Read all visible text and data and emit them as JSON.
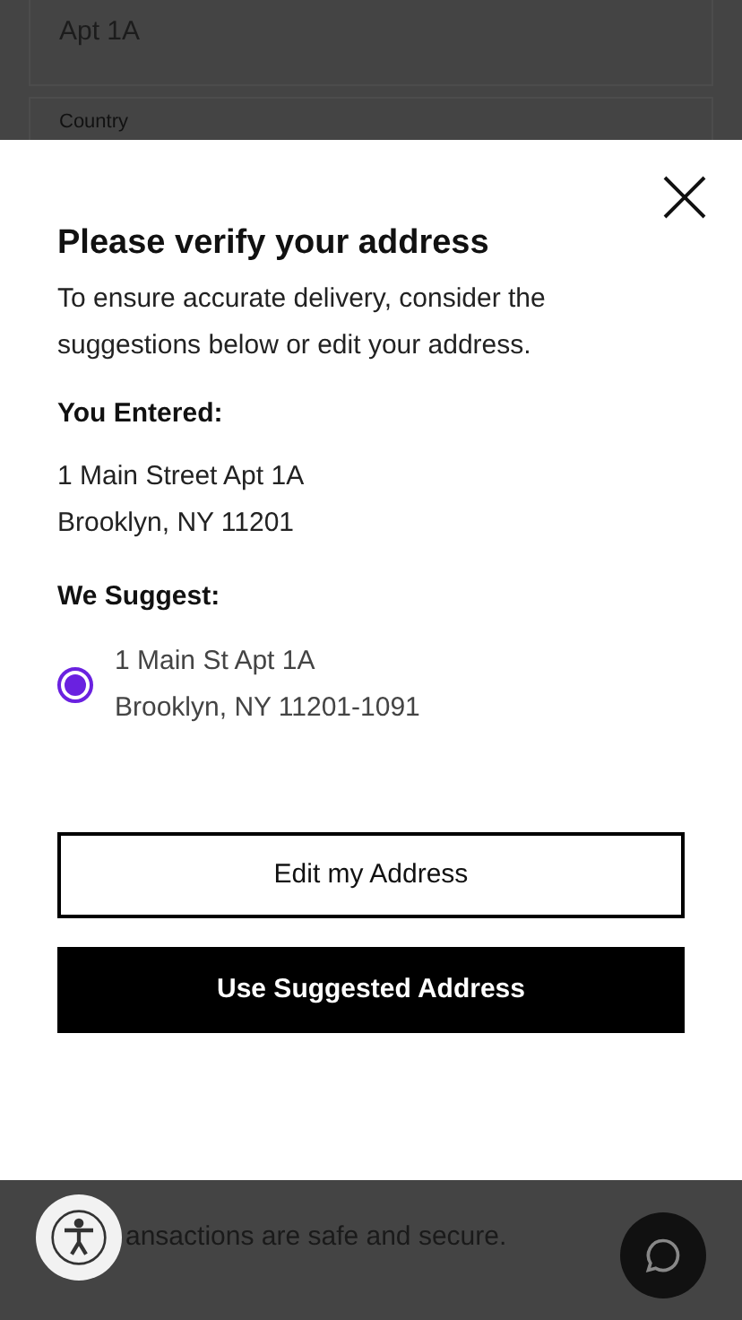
{
  "background_form": {
    "address_line_2_value": "Apt 1A",
    "country_label": "Country"
  },
  "dialog": {
    "title": "Please verify your address",
    "message": "To ensure accurate delivery, consider the suggestions below or edit your address.",
    "entered": {
      "heading": "You Entered:",
      "lines": [
        "1 Main Street Apt 1A",
        "Brooklyn, NY 11201"
      ]
    },
    "suggested": {
      "heading": "We Suggest:",
      "options": [
        {
          "lines": [
            "1 Main St Apt 1A",
            "Brooklyn, NY 11201-1091"
          ],
          "selected": true
        }
      ]
    },
    "buttons": [
      {
        "label": "Edit my Address",
        "kind": "outline"
      },
      {
        "label": "Use Suggested Address",
        "kind": "filled"
      }
    ]
  },
  "footer": {
    "text": "ansactions are safe and secure."
  }
}
